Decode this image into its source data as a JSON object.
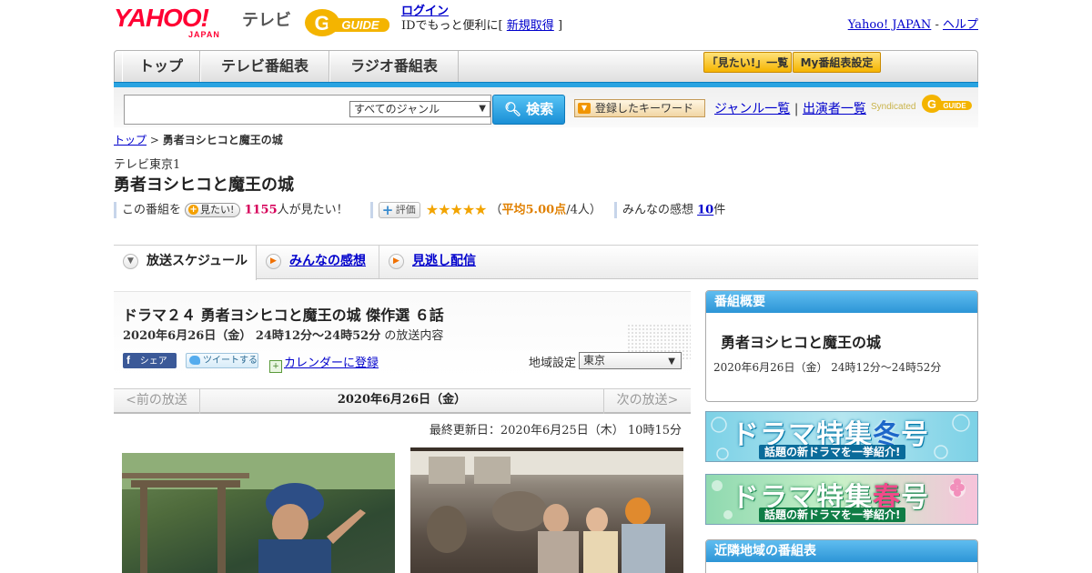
{
  "header": {
    "logo_yahoo": "YAHOO!",
    "logo_japan": "JAPAN",
    "logo_tv": "テレビ",
    "logo_gguide": "G GUIDE",
    "login": "ログイン",
    "login_sub_prefix": "IDでもっと便利に[",
    "register": "新規取得",
    "login_sub_suffix": "]",
    "yahoo_japan_link": "Yahoo! JAPAN",
    "sep": " - ",
    "help_link": "ヘルプ"
  },
  "nav": {
    "tabs": [
      "トップ",
      "テレビ番組表",
      "ラジオ番組表"
    ],
    "mitai_list": "「見たい!」一覧",
    "my_schedule": "My番組表設定"
  },
  "search": {
    "query": "",
    "genre_selected": "すべてのジャンル",
    "button": "検索",
    "keyword_button": "登録したキーワード",
    "genre_list": "ジャンル一覧",
    "divider": "|",
    "cast_list": "出演者一覧",
    "syndicated": "Syndicated"
  },
  "breadcrumb": {
    "top": "トップ",
    "sep": ">",
    "current": "勇者ヨシヒコと魔王の城"
  },
  "program": {
    "station": "テレビ東京1",
    "title": "勇者ヨシヒコと魔王の城",
    "mitai_prefix": "この番組を",
    "mitai_button": "見たい!",
    "mitai_count": "1155",
    "mitai_suffix": "人が見たい！",
    "eval_button": "評価",
    "stars": "★★★★★",
    "rating_open": "（",
    "rating_avg": "平均5.00点",
    "rating_people": "/4人）",
    "impressions_prefix": "みんなの感想",
    "impressions_count": "10",
    "impressions_suffix": "件"
  },
  "tabs": {
    "schedule": "放送スケジュール",
    "impressions": "みんなの感想",
    "streaming": "見逃し配信"
  },
  "episode": {
    "title": "ドラマ２４ 勇者ヨシヒコと魔王の城 傑作選 ６話",
    "date_bold": "2020年6月26日（金） 24時12分～24時52分",
    "date_suffix": "の放送内容",
    "fb_share": "シェア",
    "tweet": "ツイートする",
    "calendar": "カレンダーに登録",
    "region_label": "地域設定",
    "region_value": "東京"
  },
  "date_nav": {
    "prev": "<前の放送",
    "current": "2020年6月26日（金）",
    "next": "次の放送>"
  },
  "updated": "最終更新日：2020年6月25日（木） 10時15分",
  "sidebar": {
    "overview_head": "番組概要",
    "overview_title": "勇者ヨシヒコと魔王の城",
    "overview_date": "2020年6月26日（金） 24時12分～24時52分",
    "banner_winter_main": "ドラマ特集",
    "banner_winter_season": "冬",
    "banner_winter_go": "号",
    "banner_winter_sub": "話題の新ドラマを一挙紹介!",
    "banner_spring_main": "ドラマ特集",
    "banner_spring_season": "春",
    "banner_spring_go": "号",
    "banner_spring_sub": "話題の新ドラマを一挙紹介!",
    "nearby_head": "近隣地域の番組表"
  },
  "colors": {
    "yahoo_red": "#ff0033",
    "accent_blue": "#29a3e1",
    "mitai_pink": "#d6005a",
    "star_orange": "#f2a400"
  }
}
